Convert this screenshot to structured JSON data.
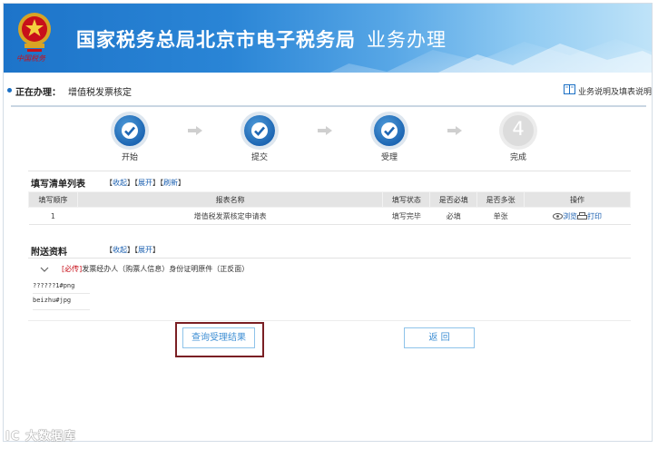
{
  "header": {
    "title": "国家税务总局北京市电子税务局",
    "subtitle": "业务办理",
    "emblem_text": "中国税务"
  },
  "status": {
    "label": "正在办理：",
    "value": "增值税发票核定",
    "help_link": "业务说明及填表说明"
  },
  "steps": [
    {
      "label": "开始",
      "state": "done"
    },
    {
      "label": "提交",
      "state": "done"
    },
    {
      "label": "受理",
      "state": "done"
    },
    {
      "label": "完成",
      "state": "todo",
      "number": "4"
    }
  ],
  "form_list": {
    "title": "填写清单列表",
    "links": [
      "收起",
      "展开",
      "刷新"
    ],
    "columns": [
      "填写顺序",
      "报表名称",
      "填写状态",
      "是否必填",
      "是否多张",
      "操作"
    ],
    "rows": [
      {
        "order": "1",
        "name": "增值税发票核定申请表",
        "status": "填写完毕",
        "required": "必填",
        "multiple": "单张",
        "view": "浏览",
        "print": "打印"
      }
    ]
  },
  "attachments": {
    "title": "附送资料",
    "links": [
      "收起",
      "展开"
    ],
    "item": {
      "required_tag": "[必传]",
      "name": "发票经办人（购票人信息）身份证明原件（正反面）"
    },
    "files": [
      "??????1#png",
      "beizhu#jpg"
    ]
  },
  "buttons": {
    "query": "查询受理结果",
    "back": "返 回"
  },
  "watermark": "IC 大数据库",
  "colors": {
    "header_blue": "#1d74c9",
    "step_done": "#1d66b3",
    "link_blue": "#1a5fb0",
    "required_red": "#c8101a",
    "highlight_border": "#7a1f24"
  }
}
